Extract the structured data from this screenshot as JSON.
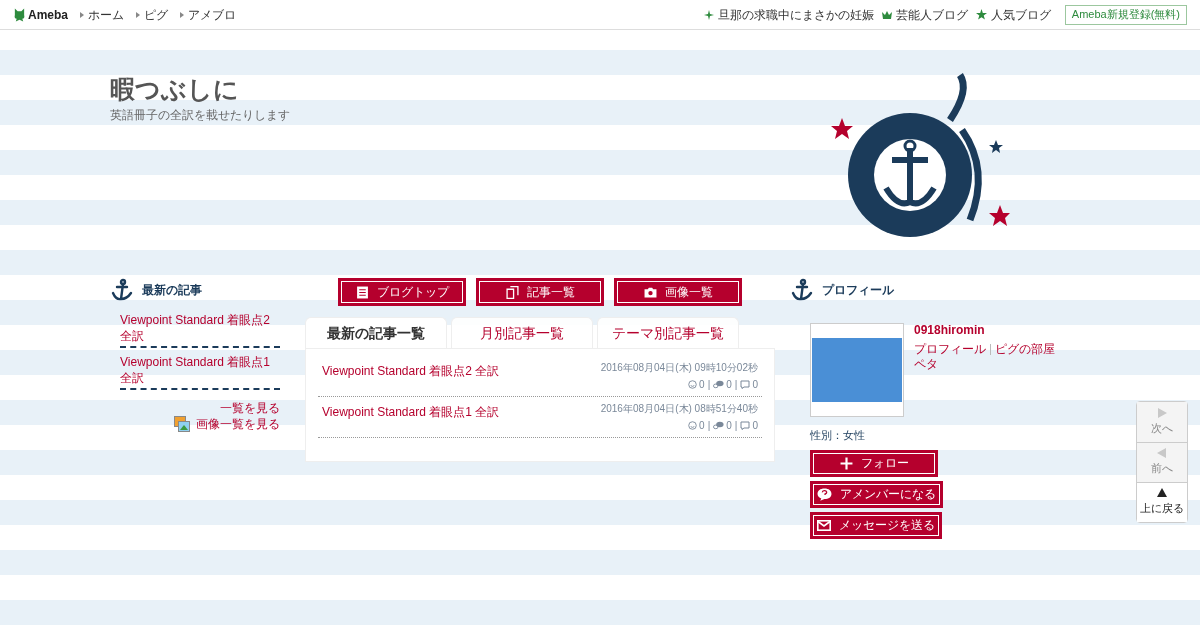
{
  "topbar": {
    "logo": "Ameba",
    "nav": [
      "ホーム",
      "ピグ",
      "アメブロ"
    ],
    "links": [
      {
        "kind": "sparkle",
        "label": "旦那の求職中にまさかの妊娠"
      },
      {
        "kind": "crown",
        "label": "芸能人ブログ"
      },
      {
        "kind": "star",
        "label": "人気ブログ"
      }
    ],
    "register": "Ameba新規登録(無料)"
  },
  "blog": {
    "title": "暇つぶしに",
    "description": "英語冊子の全訳を載せたりします"
  },
  "recent": {
    "heading": "最新の記事",
    "items": [
      "Viewpoint Standard 着眼点2 全訳",
      "Viewpoint Standard 着眼点1 全訳"
    ],
    "more": "一覧を見る",
    "images": "画像一覧を見る"
  },
  "buttons": [
    {
      "kind": "doc",
      "label": "ブログトップ"
    },
    {
      "kind": "pages",
      "label": "記事一覧"
    },
    {
      "kind": "camera",
      "label": "画像一覧"
    }
  ],
  "tabs": [
    {
      "label": "最新の記事一覧",
      "selected": true
    },
    {
      "label": "月別記事一覧",
      "selected": false
    },
    {
      "label": "テーマ別記事一覧",
      "selected": false
    }
  ],
  "entries": [
    {
      "title": "Viewpoint Standard 着眼点2 全訳",
      "date": "2016年08月04日(木) 09時10分02秒",
      "likes": "0",
      "separator_1": "|",
      "comments": "0",
      "separator_2": "|",
      "reblogs": "0"
    },
    {
      "title": "Viewpoint Standard 着眼点1 全訳",
      "date": "2016年08月04日(木) 08時51分40秒",
      "likes": "0",
      "separator_1": "|",
      "comments": "0",
      "separator_2": "|",
      "reblogs": "0"
    }
  ],
  "profile": {
    "heading": "プロフィール",
    "name": "0918hiromin",
    "links": [
      "プロフィール",
      "ピグの部屋"
    ],
    "peta": "ペタ",
    "gender": "性別：女性",
    "actions": [
      {
        "kind": "plus",
        "label": "フォロー"
      },
      {
        "kind": "bubble",
        "label": "アメンバーになる"
      },
      {
        "kind": "mail",
        "label": "メッセージを送る"
      }
    ]
  },
  "pager": [
    {
      "kind": "next",
      "label": "次へ",
      "disabled": true
    },
    {
      "kind": "prev",
      "label": "前へ",
      "disabled": true
    },
    {
      "kind": "top",
      "label": "上に戻る",
      "disabled": false
    }
  ]
}
